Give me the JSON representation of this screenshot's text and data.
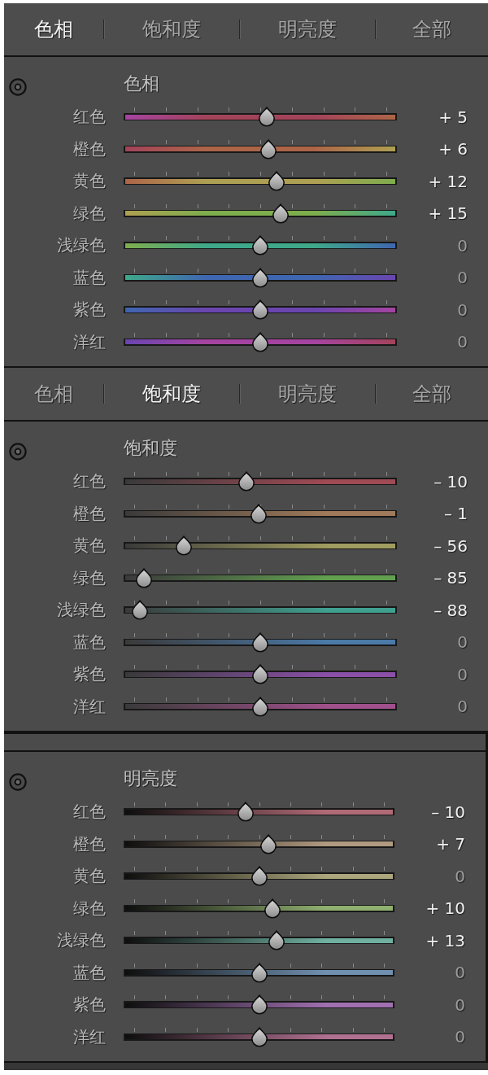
{
  "sections": [
    {
      "tabs": [
        {
          "label": "色相",
          "selected": true
        },
        {
          "label": "饱和度",
          "selected": false
        },
        {
          "label": "明亮度",
          "selected": false
        },
        {
          "label": "全部",
          "selected": false
        }
      ],
      "panel": {
        "kind": "hue",
        "title": "色相",
        "sliders": [
          {
            "label": "红色",
            "color": "#a3435a",
            "level": 0.525,
            "value": "+ 5",
            "adjusted": true
          },
          {
            "label": "橙色",
            "color": "#ad6548",
            "level": 0.53,
            "value": "+ 6",
            "adjusted": true
          },
          {
            "label": "黄色",
            "color": "#aea052",
            "level": 0.56,
            "value": "+ 12",
            "adjusted": true
          },
          {
            "label": "绿色",
            "color": "#7fad4e",
            "level": 0.575,
            "value": "+ 15",
            "adjusted": true
          },
          {
            "label": "浅绿色",
            "color": "#3fa88a",
            "level": 0.5,
            "value": "0",
            "adjusted": false
          },
          {
            "label": "蓝色",
            "color": "#3f66b0",
            "level": 0.5,
            "value": "0",
            "adjusted": false
          },
          {
            "label": "紫色",
            "color": "#6a45b0",
            "level": 0.5,
            "value": "0",
            "adjusted": false
          },
          {
            "label": "洋红",
            "color": "#a544a0",
            "level": 0.5,
            "value": "0",
            "adjusted": false
          }
        ]
      }
    },
    {
      "tabs": [
        {
          "label": "色相",
          "selected": false
        },
        {
          "label": "饱和度",
          "selected": true
        },
        {
          "label": "明亮度",
          "selected": false
        },
        {
          "label": "全部",
          "selected": false
        }
      ],
      "panel": {
        "kind": "saturation",
        "title": "饱和度",
        "sliders": [
          {
            "label": "红色",
            "color": "#a04a55",
            "level": 0.45,
            "value": "– 10",
            "adjusted": true
          },
          {
            "label": "橙色",
            "color": "#a07a5a",
            "level": 0.495,
            "value": "– 1",
            "adjusted": true
          },
          {
            "label": "黄色",
            "color": "#a09c60",
            "level": 0.22,
            "value": "– 56",
            "adjusted": true
          },
          {
            "label": "绿色",
            "color": "#62a050",
            "level": 0.075,
            "value": "– 85",
            "adjusted": true
          },
          {
            "label": "浅绿色",
            "color": "#40a090",
            "level": 0.06,
            "value": "– 88",
            "adjusted": true
          },
          {
            "label": "蓝色",
            "color": "#4a7aa8",
            "level": 0.5,
            "value": "0",
            "adjusted": false
          },
          {
            "label": "紫色",
            "color": "#8a50a8",
            "level": 0.5,
            "value": "0",
            "adjusted": false
          },
          {
            "label": "洋红",
            "color": "#a0508a",
            "level": 0.5,
            "value": "0",
            "adjusted": false
          }
        ]
      }
    },
    {
      "panel": {
        "kind": "luminance",
        "title": "明亮度",
        "sliders": [
          {
            "label": "红色",
            "color": "#b06a75",
            "level": 0.45,
            "value": "– 10",
            "adjusted": true
          },
          {
            "label": "橙色",
            "color": "#b09a80",
            "level": 0.535,
            "value": "+ 7",
            "adjusted": true
          },
          {
            "label": "黄色",
            "color": "#aca67c",
            "level": 0.5,
            "value": "0",
            "adjusted": false
          },
          {
            "label": "绿色",
            "color": "#90b070",
            "level": 0.55,
            "value": "+ 10",
            "adjusted": true
          },
          {
            "label": "浅绿色",
            "color": "#70b0a0",
            "level": 0.565,
            "value": "+ 13",
            "adjusted": true
          },
          {
            "label": "蓝色",
            "color": "#7090b0",
            "level": 0.5,
            "value": "0",
            "adjusted": false
          },
          {
            "label": "紫色",
            "color": "#a070b0",
            "level": 0.5,
            "value": "0",
            "adjusted": false
          },
          {
            "label": "洋红",
            "color": "#b07090",
            "level": 0.5,
            "value": "0",
            "adjusted": false
          }
        ]
      }
    }
  ]
}
